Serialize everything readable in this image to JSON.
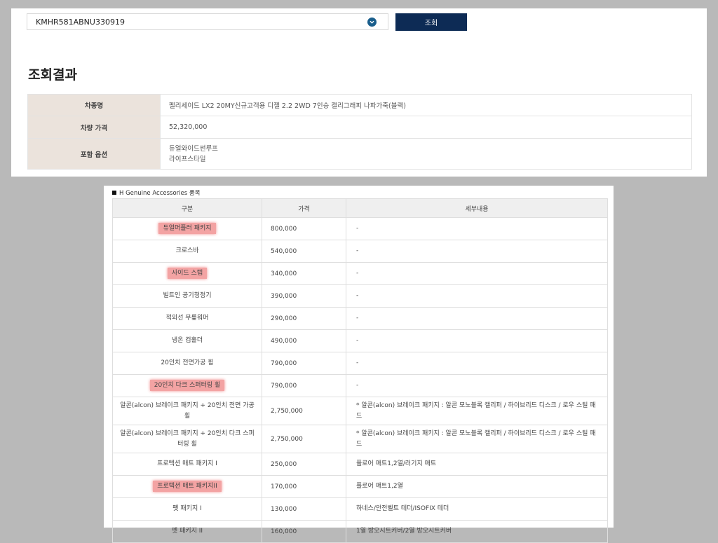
{
  "search": {
    "vin": "KMHR581ABNU330919",
    "button_label": "조회"
  },
  "result": {
    "title": "조회결과",
    "rows": [
      {
        "label": "차종명",
        "value": "펠리세이드 LX2 20MY신규고객용 디젤 2.2 2WD 7인승 캘리그래피 나파가죽(블랙)"
      },
      {
        "label": "차량 가격",
        "value": "52,320,000"
      },
      {
        "label": "포함 옵션",
        "values": [
          "듀얼와이드썬루프",
          "라이프스타일"
        ]
      }
    ]
  },
  "accessories": {
    "title": "H Genuine Accessories 품목",
    "headers": [
      "구분",
      "가격",
      "세부내용"
    ],
    "items": [
      {
        "name": "듀얼머플러 패키지",
        "price": "800,000",
        "detail": "-",
        "highlighted": true
      },
      {
        "name": "크로스바",
        "price": "540,000",
        "detail": "-",
        "highlighted": false
      },
      {
        "name": "사이드 스텝",
        "price": "340,000",
        "detail": "-",
        "highlighted": true
      },
      {
        "name": "빌트인 공기청정기",
        "price": "390,000",
        "detail": "-",
        "highlighted": false
      },
      {
        "name": "적외선 무릎워머",
        "price": "290,000",
        "detail": "-",
        "highlighted": false
      },
      {
        "name": "냉온 컵홀더",
        "price": "490,000",
        "detail": "-",
        "highlighted": false
      },
      {
        "name": "20인치 전면가공 휠",
        "price": "790,000",
        "detail": "-",
        "highlighted": false
      },
      {
        "name": "20인치 다크 스퍼터링 휠",
        "price": "790,000",
        "detail": "-",
        "highlighted": true
      },
      {
        "name": "알콘(alcon) 브레이크 패키지 + 20인치 전면 가공 휠",
        "price": "2,750,000",
        "detail": "* 알콘(alcon) 브레이크 패키지 : 알콘 모노블록 캘리퍼 / 하이브리드 디스크 / 로우 스틸 패드",
        "highlighted": false
      },
      {
        "name": "알콘(alcon) 브레이크 패키지 + 20인치 다크 스퍼터링 휠",
        "price": "2,750,000",
        "detail": "* 알콘(alcon) 브레이크 패키지 : 알콘 모노블록 캘리퍼 / 하이브리드 디스크 / 로우 스틸 패드",
        "highlighted": false
      },
      {
        "name": "프로텍션 매트 패키지 I",
        "price": "250,000",
        "detail": "플로어 매트1,2열/러기지 매트",
        "highlighted": false
      },
      {
        "name": "프로텍션 매트 패키지II",
        "price": "170,000",
        "detail": "플로어 매트1,2열",
        "highlighted": true
      },
      {
        "name": "펫 패키지 I",
        "price": "130,000",
        "detail": "하네스/안전벨트 테더/ISOFIX 테더",
        "highlighted": false
      },
      {
        "name": "펫 패키지 II",
        "price": "160,000",
        "detail": "1열 방오시트커버/2열 방오시트커버",
        "highlighted": false
      }
    ]
  },
  "colors": {
    "button_bg": "#0d2b55",
    "label_cell_bg": "#ebe3dc",
    "highlight": "#f3a3a3",
    "chevron": "#1a5e8c"
  }
}
